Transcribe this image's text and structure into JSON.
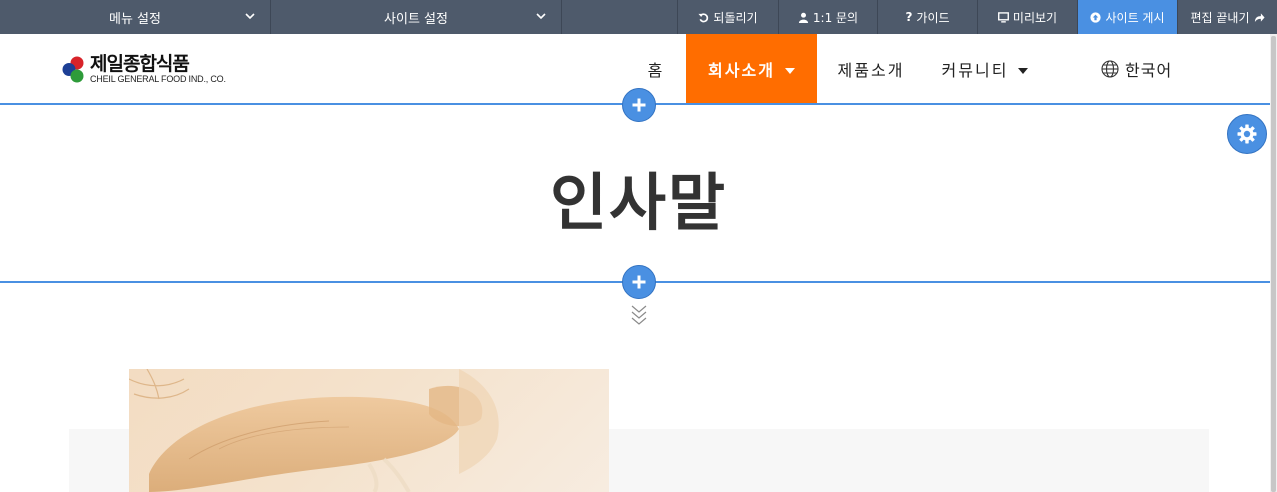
{
  "toolbar": {
    "menu_settings": "메뉴 설정",
    "site_settings": "사이트 설정",
    "undo": "되돌리기",
    "inquiry": "1:1 문의",
    "guide": "가이드",
    "preview": "미리보기",
    "publish": "사이트 게시",
    "finish_edit": "편집 끝내기"
  },
  "logo": {
    "korean": "제일종합식품",
    "english": "CHEIL GENERAL FOOD IND., CO."
  },
  "nav": {
    "items": [
      {
        "label": "홈"
      },
      {
        "label": "회사소개"
      },
      {
        "label": "제품소개"
      },
      {
        "label": "커뮤니티"
      }
    ],
    "language": "한국어"
  },
  "page": {
    "title": "인사말"
  },
  "colors": {
    "toolbar_bg": "#4e5a6b",
    "accent_blue": "#4a90e2",
    "nav_active": "#ff6d00"
  },
  "icons": [
    "undo-icon",
    "user-icon",
    "question-icon",
    "monitor-icon",
    "upload-icon",
    "share-icon",
    "globe-icon",
    "plus-icon",
    "gear-icon",
    "chevron-down-icon",
    "double-chevron-down-icon"
  ]
}
